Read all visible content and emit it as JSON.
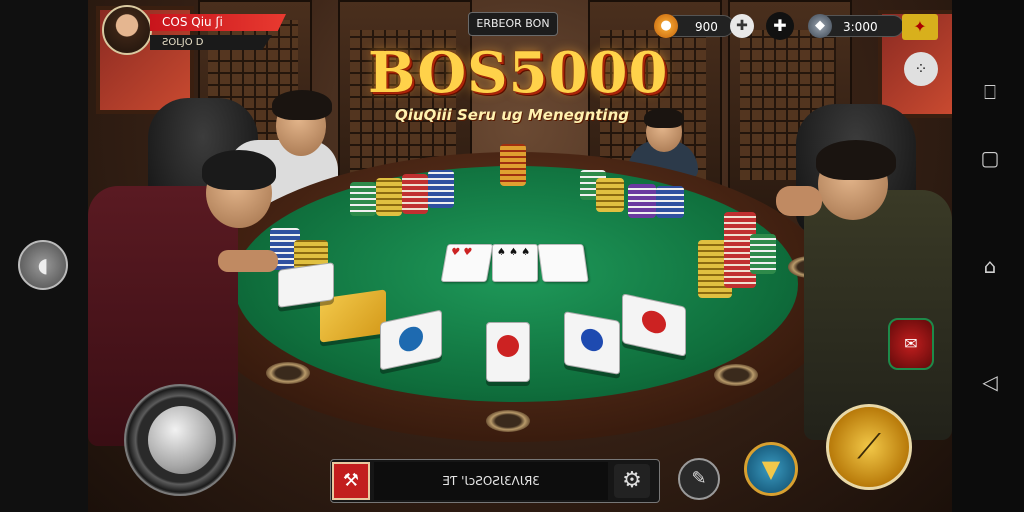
{
  "player": {
    "name": "COS Qiu ʃi",
    "coins": "ƧOLJO D"
  },
  "event": {
    "label": "ERBEOR BON"
  },
  "logo": {
    "title": "BOS5000",
    "subtitle": "QiuQiii Seru ug Menegnting"
  },
  "resources": [
    {
      "value": "900",
      "icon": "chip-icon"
    },
    {
      "value": "3:000",
      "icon": "gem-icon"
    }
  ],
  "chat": {
    "text": "ƎƬ 'ƖɔƧOƧƖƐɅƖЯƐ"
  },
  "colors": {
    "felt": "#0f6e3c",
    "accent": "#ffd24a",
    "red": "#c8141c"
  }
}
